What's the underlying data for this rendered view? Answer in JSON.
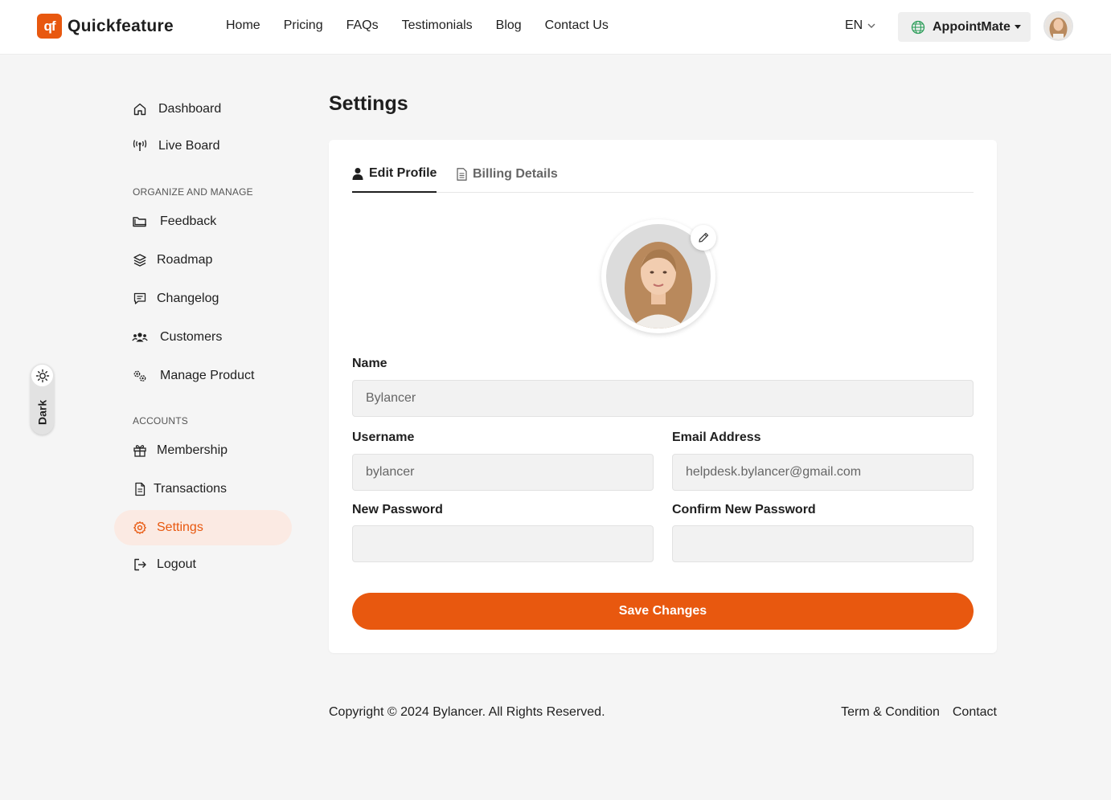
{
  "brand": {
    "logo_mark": "qf",
    "name": "Quickfeature",
    "accent_color": "#e8580f"
  },
  "nav": {
    "items": [
      "Home",
      "Pricing",
      "FAQs",
      "Testimonials",
      "Blog",
      "Contact Us"
    ]
  },
  "header": {
    "language": "EN",
    "project_label": "AppointMate"
  },
  "theme_toggle": {
    "label": "Dark"
  },
  "sidebar": {
    "items_top": [
      {
        "label": "Dashboard",
        "icon": "home-icon"
      },
      {
        "label": "Live Board",
        "icon": "broadcast-icon"
      }
    ],
    "section_organize": "ORGANIZE AND MANAGE",
    "items_organize": [
      {
        "label": "Feedback",
        "icon": "folder-icon"
      },
      {
        "label": "Roadmap",
        "icon": "layers-icon"
      },
      {
        "label": "Changelog",
        "icon": "message-icon"
      },
      {
        "label": "Customers",
        "icon": "users-icon"
      },
      {
        "label": "Manage Product",
        "icon": "gears-icon"
      }
    ],
    "section_accounts": "ACCOUNTS",
    "items_accounts": [
      {
        "label": "Membership",
        "icon": "gift-icon"
      },
      {
        "label": "Transactions",
        "icon": "document-icon"
      },
      {
        "label": "Settings",
        "icon": "gear-icon",
        "active": true
      },
      {
        "label": "Logout",
        "icon": "logout-icon"
      }
    ]
  },
  "main": {
    "title": "Settings",
    "tabs": [
      {
        "label": "Edit Profile",
        "icon": "user-icon",
        "active": true
      },
      {
        "label": "Billing Details",
        "icon": "document-icon",
        "active": false
      }
    ],
    "form": {
      "name_label": "Name",
      "name_value": "Bylancer",
      "username_label": "Username",
      "username_value": "bylancer",
      "email_label": "Email Address",
      "email_value": "helpdesk.bylancer@gmail.com",
      "new_password_label": "New Password",
      "new_password_value": "",
      "confirm_password_label": "Confirm New Password",
      "confirm_password_value": "",
      "save_label": "Save Changes"
    }
  },
  "footer": {
    "copyright": "Copyright © 2024 Bylancer. All Rights Reserved.",
    "links": [
      "Term & Condition",
      "Contact"
    ]
  }
}
